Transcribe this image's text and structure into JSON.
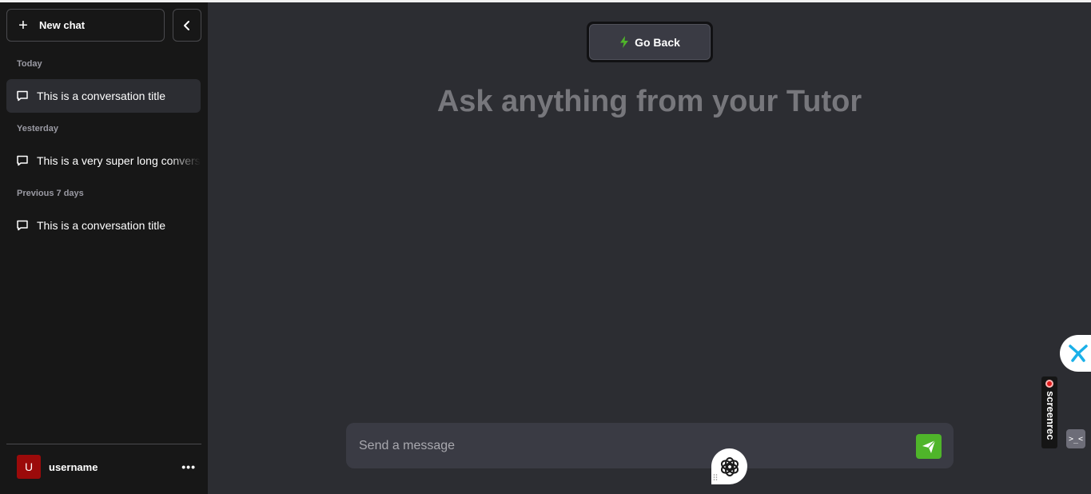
{
  "sidebar": {
    "new_chat_label": "New chat",
    "sections": [
      {
        "label": "Today",
        "items": [
          "This is a conversation title"
        ]
      },
      {
        "label": "Yesterday",
        "items": [
          "This is a very super long conversation title"
        ]
      },
      {
        "label": "Previous 7 days",
        "items": [
          "This is a conversation title"
        ]
      }
    ],
    "user": {
      "avatar_letter": "U",
      "name": "username",
      "menu": "•••"
    }
  },
  "main": {
    "go_back_label": "Go Back",
    "heading": "Ask anything from your Tutor",
    "input_placeholder": "Send a message"
  },
  "overlay": {
    "screenrec_label": "screenrec",
    "tiny_icon_label": ">_<"
  },
  "colors": {
    "sidebar_bg": "#171717",
    "main_bg": "#2c2d32",
    "send_button": "#4fb52a",
    "avatar": "#9b0a0a",
    "bolt": "#4fb52a"
  }
}
